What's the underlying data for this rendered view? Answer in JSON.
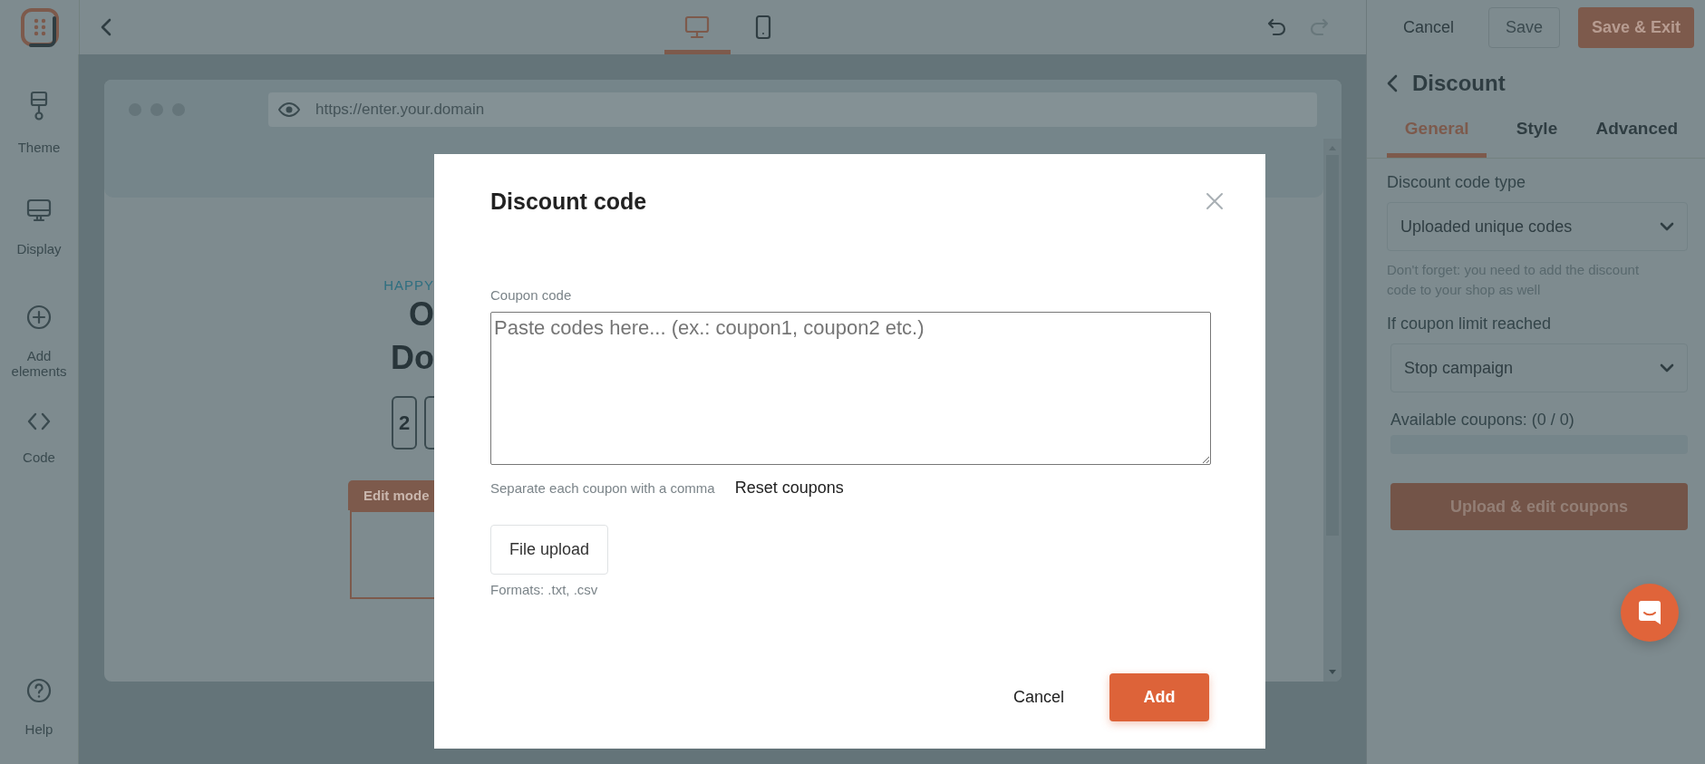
{
  "topbar": {
    "devices": [
      {
        "kind": "desktop",
        "selected": true
      },
      {
        "kind": "mobile",
        "selected": false
      }
    ],
    "undo": {
      "disabled": false
    },
    "redo": {
      "disabled": true
    },
    "buttons": [
      {
        "label": "Cancel",
        "kind": "text"
      },
      {
        "label": "Save",
        "kind": "outline"
      },
      {
        "label": "Save & Exit",
        "kind": "primary"
      }
    ]
  },
  "sidebar": {
    "items": [
      {
        "label": "Theme",
        "kind": "brush"
      },
      {
        "label": "Display",
        "kind": "monitor"
      },
      {
        "label": "Add elements",
        "kind": "plus"
      },
      {
        "label": "Code",
        "kind": "code"
      }
    ],
    "help": {
      "label": "Help"
    }
  },
  "preview": {
    "url": "https://enter.your.domain",
    "eyebrow": "HAPPY",
    "headline": [
      "O",
      "Do"
    ],
    "countdown": [
      "2"
    ],
    "edit_tag": "Edit mode"
  },
  "panel": {
    "title": "Discount",
    "tabs": [
      {
        "label": "General",
        "selected": true
      },
      {
        "label": "Style",
        "selected": false
      },
      {
        "label": "Advanced",
        "selected": false
      }
    ],
    "fields": [
      {
        "label": "Discount code type",
        "value": "Uploaded unique codes",
        "hint": "Don't forget: you need to add the discount code to your shop as well"
      },
      {
        "label": "If coupon limit reached",
        "value": "Stop campaign"
      }
    ],
    "available": {
      "label": "Available coupons: (0 / 0)",
      "level": 0
    },
    "button": "Upload & edit coupons"
  },
  "dialog": {
    "title": "Discount code",
    "field_label": "Coupon code",
    "placeholder": "Paste codes here... (ex.: coupon1, coupon2 etc.)",
    "helper": "Separate each coupon with a comma",
    "reset_link": "Reset coupons",
    "upload_button": "File upload",
    "formats": "Formats: .txt, .csv",
    "buttons": [
      {
        "label": "Cancel",
        "kind": "text"
      },
      {
        "label": "Add",
        "kind": "primary"
      }
    ]
  }
}
